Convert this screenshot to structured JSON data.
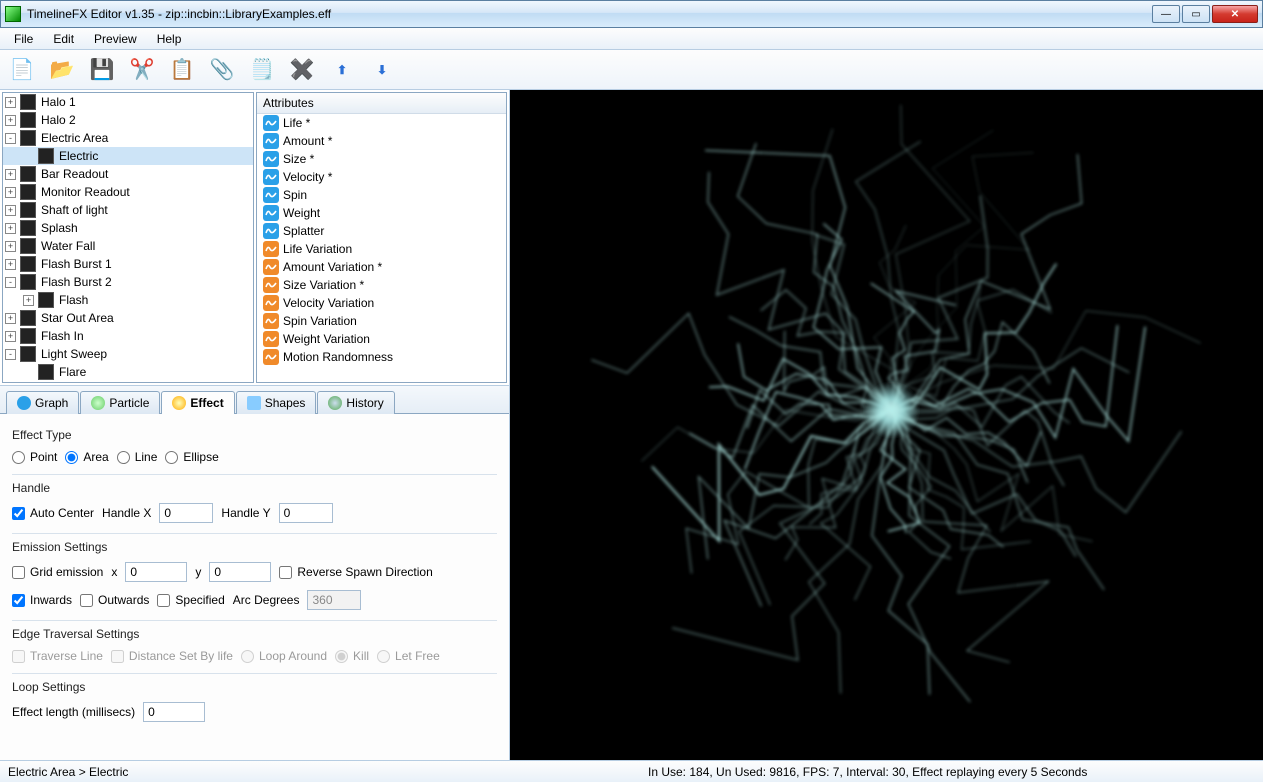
{
  "window": {
    "title": "TimelineFX Editor v1.35 - zip::incbin::LibraryExamples.eff"
  },
  "menu": {
    "file": "File",
    "edit": "Edit",
    "preview": "Preview",
    "help": "Help"
  },
  "tree": {
    "items": [
      {
        "label": "Halo 1",
        "toggle": "+",
        "indent": 0
      },
      {
        "label": "Halo 2",
        "toggle": "+",
        "indent": 0
      },
      {
        "label": "Electric Area",
        "toggle": "-",
        "indent": 0
      },
      {
        "label": "Electric",
        "toggle": "",
        "indent": 1,
        "selected": true
      },
      {
        "label": "Bar Readout",
        "toggle": "+",
        "indent": 0
      },
      {
        "label": "Monitor Readout",
        "toggle": "+",
        "indent": 0
      },
      {
        "label": "Shaft of light",
        "toggle": "+",
        "indent": 0
      },
      {
        "label": "Splash",
        "toggle": "+",
        "indent": 0
      },
      {
        "label": "Water Fall",
        "toggle": "+",
        "indent": 0
      },
      {
        "label": "Flash Burst 1",
        "toggle": "+",
        "indent": 0
      },
      {
        "label": "Flash Burst 2",
        "toggle": "-",
        "indent": 0
      },
      {
        "label": "Flash",
        "toggle": "+",
        "indent": 1
      },
      {
        "label": "Star Out Area",
        "toggle": "+",
        "indent": 0
      },
      {
        "label": "Flash In",
        "toggle": "+",
        "indent": 0
      },
      {
        "label": "Light Sweep",
        "toggle": "-",
        "indent": 0
      },
      {
        "label": "Flare",
        "toggle": "",
        "indent": 1
      }
    ]
  },
  "attributes": {
    "header": "Attributes",
    "items": [
      {
        "label": "Life *",
        "kind": "blue"
      },
      {
        "label": "Amount *",
        "kind": "blue"
      },
      {
        "label": "Size *",
        "kind": "blue"
      },
      {
        "label": "Velocity *",
        "kind": "blue"
      },
      {
        "label": "Spin",
        "kind": "blue"
      },
      {
        "label": "Weight",
        "kind": "blue"
      },
      {
        "label": "Splatter",
        "kind": "blue"
      },
      {
        "label": "Life Variation",
        "kind": "orange"
      },
      {
        "label": "Amount Variation *",
        "kind": "orange"
      },
      {
        "label": "Size Variation *",
        "kind": "orange"
      },
      {
        "label": "Velocity Variation",
        "kind": "orange"
      },
      {
        "label": "Spin Variation",
        "kind": "orange"
      },
      {
        "label": "Weight Variation",
        "kind": "orange"
      },
      {
        "label": "Motion Randomness",
        "kind": "orange"
      }
    ]
  },
  "tabs": {
    "graph": "Graph",
    "particle": "Particle",
    "effect": "Effect",
    "shapes": "Shapes",
    "history": "History"
  },
  "form": {
    "effectType": {
      "title": "Effect Type",
      "point": "Point",
      "area": "Area",
      "line": "Line",
      "ellipse": "Ellipse",
      "selected": "Area"
    },
    "handle": {
      "title": "Handle",
      "autoCenter": "Auto Center",
      "handleXLabel": "Handle X",
      "handleXValue": "0",
      "handleYLabel": "Handle Y",
      "handleYValue": "0",
      "autoCenterChecked": true
    },
    "emission": {
      "title": "Emission Settings",
      "gridEmission": "Grid emission",
      "gridChecked": false,
      "xLabel": "x",
      "xValue": "0",
      "yLabel": "y",
      "yValue": "0",
      "reverse": "Reverse Spawn Direction",
      "reverseChecked": false,
      "inwards": "Inwards",
      "inwardsChecked": true,
      "outwards": "Outwards",
      "outwardsChecked": false,
      "specified": "Specified",
      "specifiedChecked": false,
      "arcLabel": "Arc Degrees",
      "arcValue": "360"
    },
    "edge": {
      "title": "Edge Traversal Settings",
      "traverse": "Traverse Line",
      "distance": "Distance Set By life",
      "loopAround": "Loop Around",
      "kill": "Kill",
      "letFree": "Let Free"
    },
    "loop": {
      "title": "Loop Settings",
      "label": "Effect length (millisecs)",
      "value": "0"
    }
  },
  "status": {
    "breadcrumb": "Electric Area  >  Electric",
    "info": "In Use: 184, Un Used: 9816, FPS: 7, Interval: 30, Effect replaying every 5 Seconds"
  }
}
